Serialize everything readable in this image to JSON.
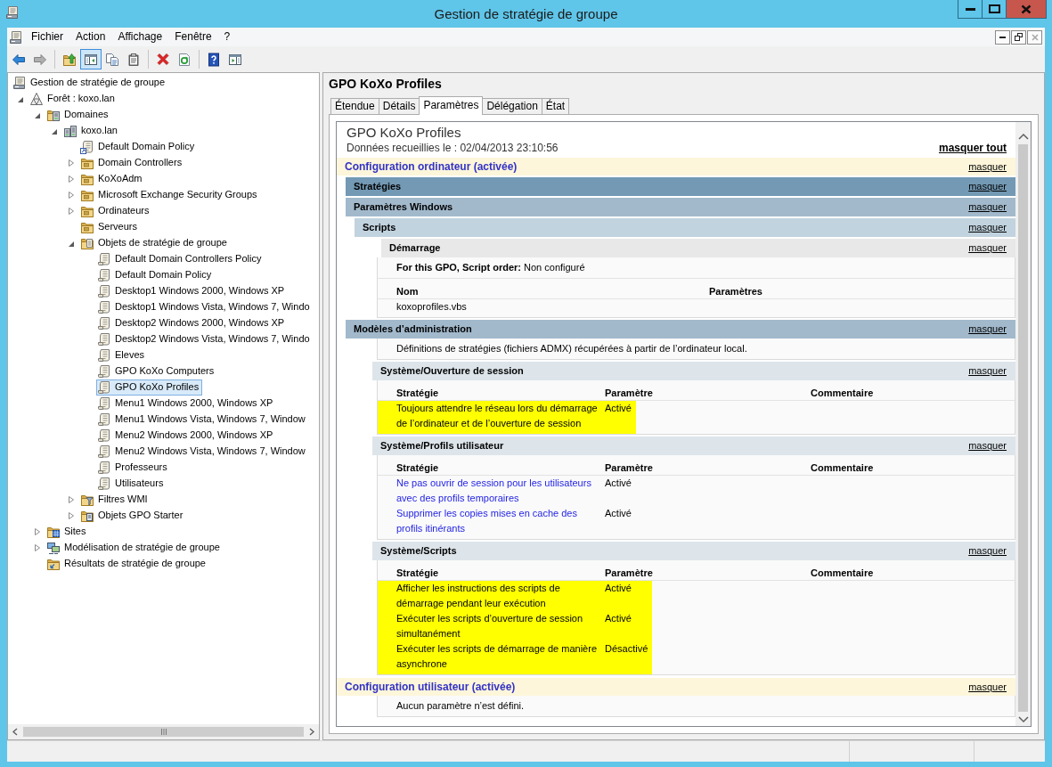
{
  "window": {
    "title": "Gestion de stratégie de groupe"
  },
  "menu": [
    "Fichier",
    "Action",
    "Affichage",
    "Fenêtre",
    "?"
  ],
  "toolbar": [
    {
      "buttons": [
        {
          "kind": "back",
          "disabled": false,
          "pressed": false
        },
        {
          "kind": "forward",
          "disabled": true,
          "pressed": false
        }
      ]
    },
    {
      "buttons": [
        {
          "kind": "up",
          "disabled": false,
          "pressed": false
        },
        {
          "kind": "tree",
          "disabled": false,
          "pressed": true
        },
        {
          "kind": "copy",
          "disabled": false,
          "pressed": false
        },
        {
          "kind": "paste",
          "disabled": false,
          "pressed": false
        }
      ]
    },
    {
      "buttons": [
        {
          "kind": "delete",
          "disabled": false,
          "pressed": false
        },
        {
          "kind": "refresh",
          "disabled": false,
          "pressed": false
        }
      ]
    },
    {
      "buttons": [
        {
          "kind": "help",
          "disabled": false,
          "pressed": false
        },
        {
          "kind": "actions",
          "disabled": false,
          "pressed": false
        }
      ]
    }
  ],
  "tree": [
    {
      "label": "Gestion de stratégie de groupe",
      "kind": "console",
      "selected": false,
      "children": [
        {
          "label": "Forêt : koxo.lan",
          "kind": "forest",
          "expanded": true,
          "selected": false,
          "children": [
            {
              "label": "Domaines",
              "kind": "domains",
              "expanded": true,
              "selected": false,
              "children": [
                {
                  "label": "koxo.lan",
                  "kind": "domain",
                  "expanded": true,
                  "selected": false,
                  "children": [
                    {
                      "label": "Default Domain Policy",
                      "kind": "link",
                      "selected": false
                    },
                    {
                      "label": "Domain Controllers",
                      "kind": "ou",
                      "expanded": false,
                      "selected": false
                    },
                    {
                      "label": "KoXoAdm",
                      "kind": "ou",
                      "expanded": false,
                      "selected": false
                    },
                    {
                      "label": "Microsoft Exchange Security Groups",
                      "kind": "ou",
                      "expanded": false,
                      "selected": false
                    },
                    {
                      "label": "Ordinateurs",
                      "kind": "ou",
                      "expanded": false,
                      "selected": false
                    },
                    {
                      "label": "Serveurs",
                      "kind": "ou",
                      "selected": false
                    },
                    {
                      "label": "Objets de stratégie de groupe",
                      "kind": "gpos",
                      "expanded": true,
                      "selected": false,
                      "children": [
                        {
                          "label": "Default Domain Controllers Policy",
                          "kind": "gpo",
                          "selected": false
                        },
                        {
                          "label": "Default Domain Policy",
                          "kind": "gpo",
                          "selected": false
                        },
                        {
                          "label": "Desktop1 Windows 2000, Windows XP",
                          "kind": "gpo",
                          "selected": false
                        },
                        {
                          "label": "Desktop1 Windows Vista, Windows 7, Windo",
                          "kind": "gpo",
                          "selected": false
                        },
                        {
                          "label": "Desktop2 Windows 2000, Windows XP",
                          "kind": "gpo",
                          "selected": false
                        },
                        {
                          "label": "Desktop2 Windows Vista, Windows 7, Windo",
                          "kind": "gpo",
                          "selected": false
                        },
                        {
                          "label": "Eleves",
                          "kind": "gpo",
                          "selected": false
                        },
                        {
                          "label": "GPO KoXo Computers",
                          "kind": "gpo",
                          "selected": false
                        },
                        {
                          "label": "GPO KoXo Profiles",
                          "kind": "gpo",
                          "selected": true
                        },
                        {
                          "label": "Menu1 Windows 2000, Windows XP",
                          "kind": "gpo",
                          "selected": false
                        },
                        {
                          "label": "Menu1 Windows Vista, Windows 7, Window",
                          "kind": "gpo",
                          "selected": false
                        },
                        {
                          "label": "Menu2 Windows 2000, Windows XP",
                          "kind": "gpo",
                          "selected": false
                        },
                        {
                          "label": "Menu2 Windows Vista, Windows 7, Window",
                          "kind": "gpo",
                          "selected": false
                        },
                        {
                          "label": "Professeurs",
                          "kind": "gpo",
                          "selected": false
                        },
                        {
                          "label": "Utilisateurs",
                          "kind": "gpo",
                          "selected": false
                        }
                      ]
                    },
                    {
                      "label": "Filtres WMI",
                      "kind": "wmi",
                      "expanded": false,
                      "selected": false
                    },
                    {
                      "label": "Objets GPO Starter",
                      "kind": "starter",
                      "expanded": false,
                      "selected": false
                    }
                  ]
                }
              ]
            },
            {
              "label": "Sites",
              "kind": "sites",
              "expanded": false,
              "selected": false
            },
            {
              "label": "Modélisation de stratégie de groupe",
              "kind": "modeling",
              "expanded": false,
              "selected": false
            },
            {
              "label": "Résultats de stratégie de groupe",
              "kind": "results",
              "selected": false
            }
          ]
        }
      ]
    }
  ],
  "details": {
    "title": "GPO KoXo Profiles",
    "tabs": [
      {
        "label": "Étendue",
        "selected": false
      },
      {
        "label": "Détails",
        "selected": false
      },
      {
        "label": "Paramètres",
        "selected": true
      },
      {
        "label": "Délégation",
        "selected": false
      },
      {
        "label": "État",
        "selected": false
      }
    ],
    "report": {
      "title": "GPO KoXo Profiles",
      "collected": "Données recueillies le : 02/04/2013 23:10:56",
      "hide_all": "masquer tout",
      "sections": [
        {
          "kind": "config",
          "title": "Configuration ordinateur (activée)",
          "toggle": "masquer",
          "children": [
            {
              "kind": "group",
              "title": "Stratégies",
              "toggle": "masquer",
              "children": [
                {
                  "kind": "group",
                  "title": "Paramètres Windows",
                  "toggle": "masquer",
                  "children": [
                    {
                      "kind": "group",
                      "title": "Scripts",
                      "toggle": "masquer",
                      "children": [
                        {
                          "kind": "extension",
                          "title": "Démarrage",
                          "toggle": "masquer",
                          "content": [
                            {
                              "kind": "text",
                              "text": "**For this GPO, Script order:** Non configuré"
                            },
                            {
                              "kind": "scripts",
                              "columns": [
                                "Nom",
                                "Paramètres"
                              ],
                              "rows": [
                                {
                                  "cells": [
                                    "koxoprofiles.vbs"
                                  ]
                                }
                              ]
                            }
                          ]
                        }
                      ]
                    }
                  ]
                },
                {
                  "kind": "group",
                  "title": "Modèles d’administration",
                  "toggle": "masquer",
                  "content": [
                    {
                      "kind": "text",
                      "text": "Définitions de stratégies (fichiers ADMX) récupérées à partir de l’ordinateur local."
                    }
                  ],
                  "children": [
                    {
                      "kind": "category",
                      "title": "Système/Ouverture de session",
                      "toggle": "masquer",
                      "content": [
                        {
                          "kind": "policies",
                          "columns": [
                            "Stratégie",
                            "Paramètre",
                            "Commentaire"
                          ],
                          "rows": [
                            {
                              "cells": [
                                "Toujours attendre le réseau lors du démarrage de l’ordinateur et de l’ouverture de session",
                                "Activé"
                              ],
                              "highlighted": true
                            }
                          ]
                        }
                      ]
                    },
                    {
                      "kind": "category",
                      "title": "Système/Profils utilisateur",
                      "toggle": "masquer",
                      "content": [
                        {
                          "kind": "policies",
                          "columns": [
                            "Stratégie",
                            "Paramètre",
                            "Commentaire"
                          ],
                          "rows": [
                            {
                              "cells": [
                                "Ne pas ouvrir de session pour les utilisateurs avec des profils temporaires",
                                "Activé"
                              ],
                              "highlighted": false
                            },
                            {
                              "cells": [
                                "Supprimer les copies mises en cache des profils itinérants",
                                "Activé"
                              ],
                              "highlighted": false
                            }
                          ]
                        }
                      ]
                    },
                    {
                      "kind": "category",
                      "title": "Système/Scripts",
                      "toggle": "masquer",
                      "content": [
                        {
                          "kind": "policies",
                          "columns": [
                            "Stratégie",
                            "Paramètre",
                            "Commentaire"
                          ],
                          "rows": [
                            {
                              "cells": [
                                "Afficher les instructions des scripts de démarrage pendant leur exécution",
                                "Activé"
                              ],
                              "highlighted": true
                            },
                            {
                              "cells": [
                                "Exécuter les scripts d’ouverture de session simultanément",
                                "Activé"
                              ],
                              "highlighted": true
                            },
                            {
                              "cells": [
                                "Exécuter les scripts de démarrage de manière asynchrone",
                                "Désactivé"
                              ],
                              "highlighted": true
                            }
                          ]
                        }
                      ]
                    }
                  ]
                }
              ]
            }
          ]
        },
        {
          "kind": "config",
          "title": "Configuration utilisateur (activée)",
          "toggle": "masquer",
          "content": [
            {
              "kind": "text",
              "text": "Aucun paramètre n’est défini."
            }
          ]
        }
      ]
    }
  }
}
